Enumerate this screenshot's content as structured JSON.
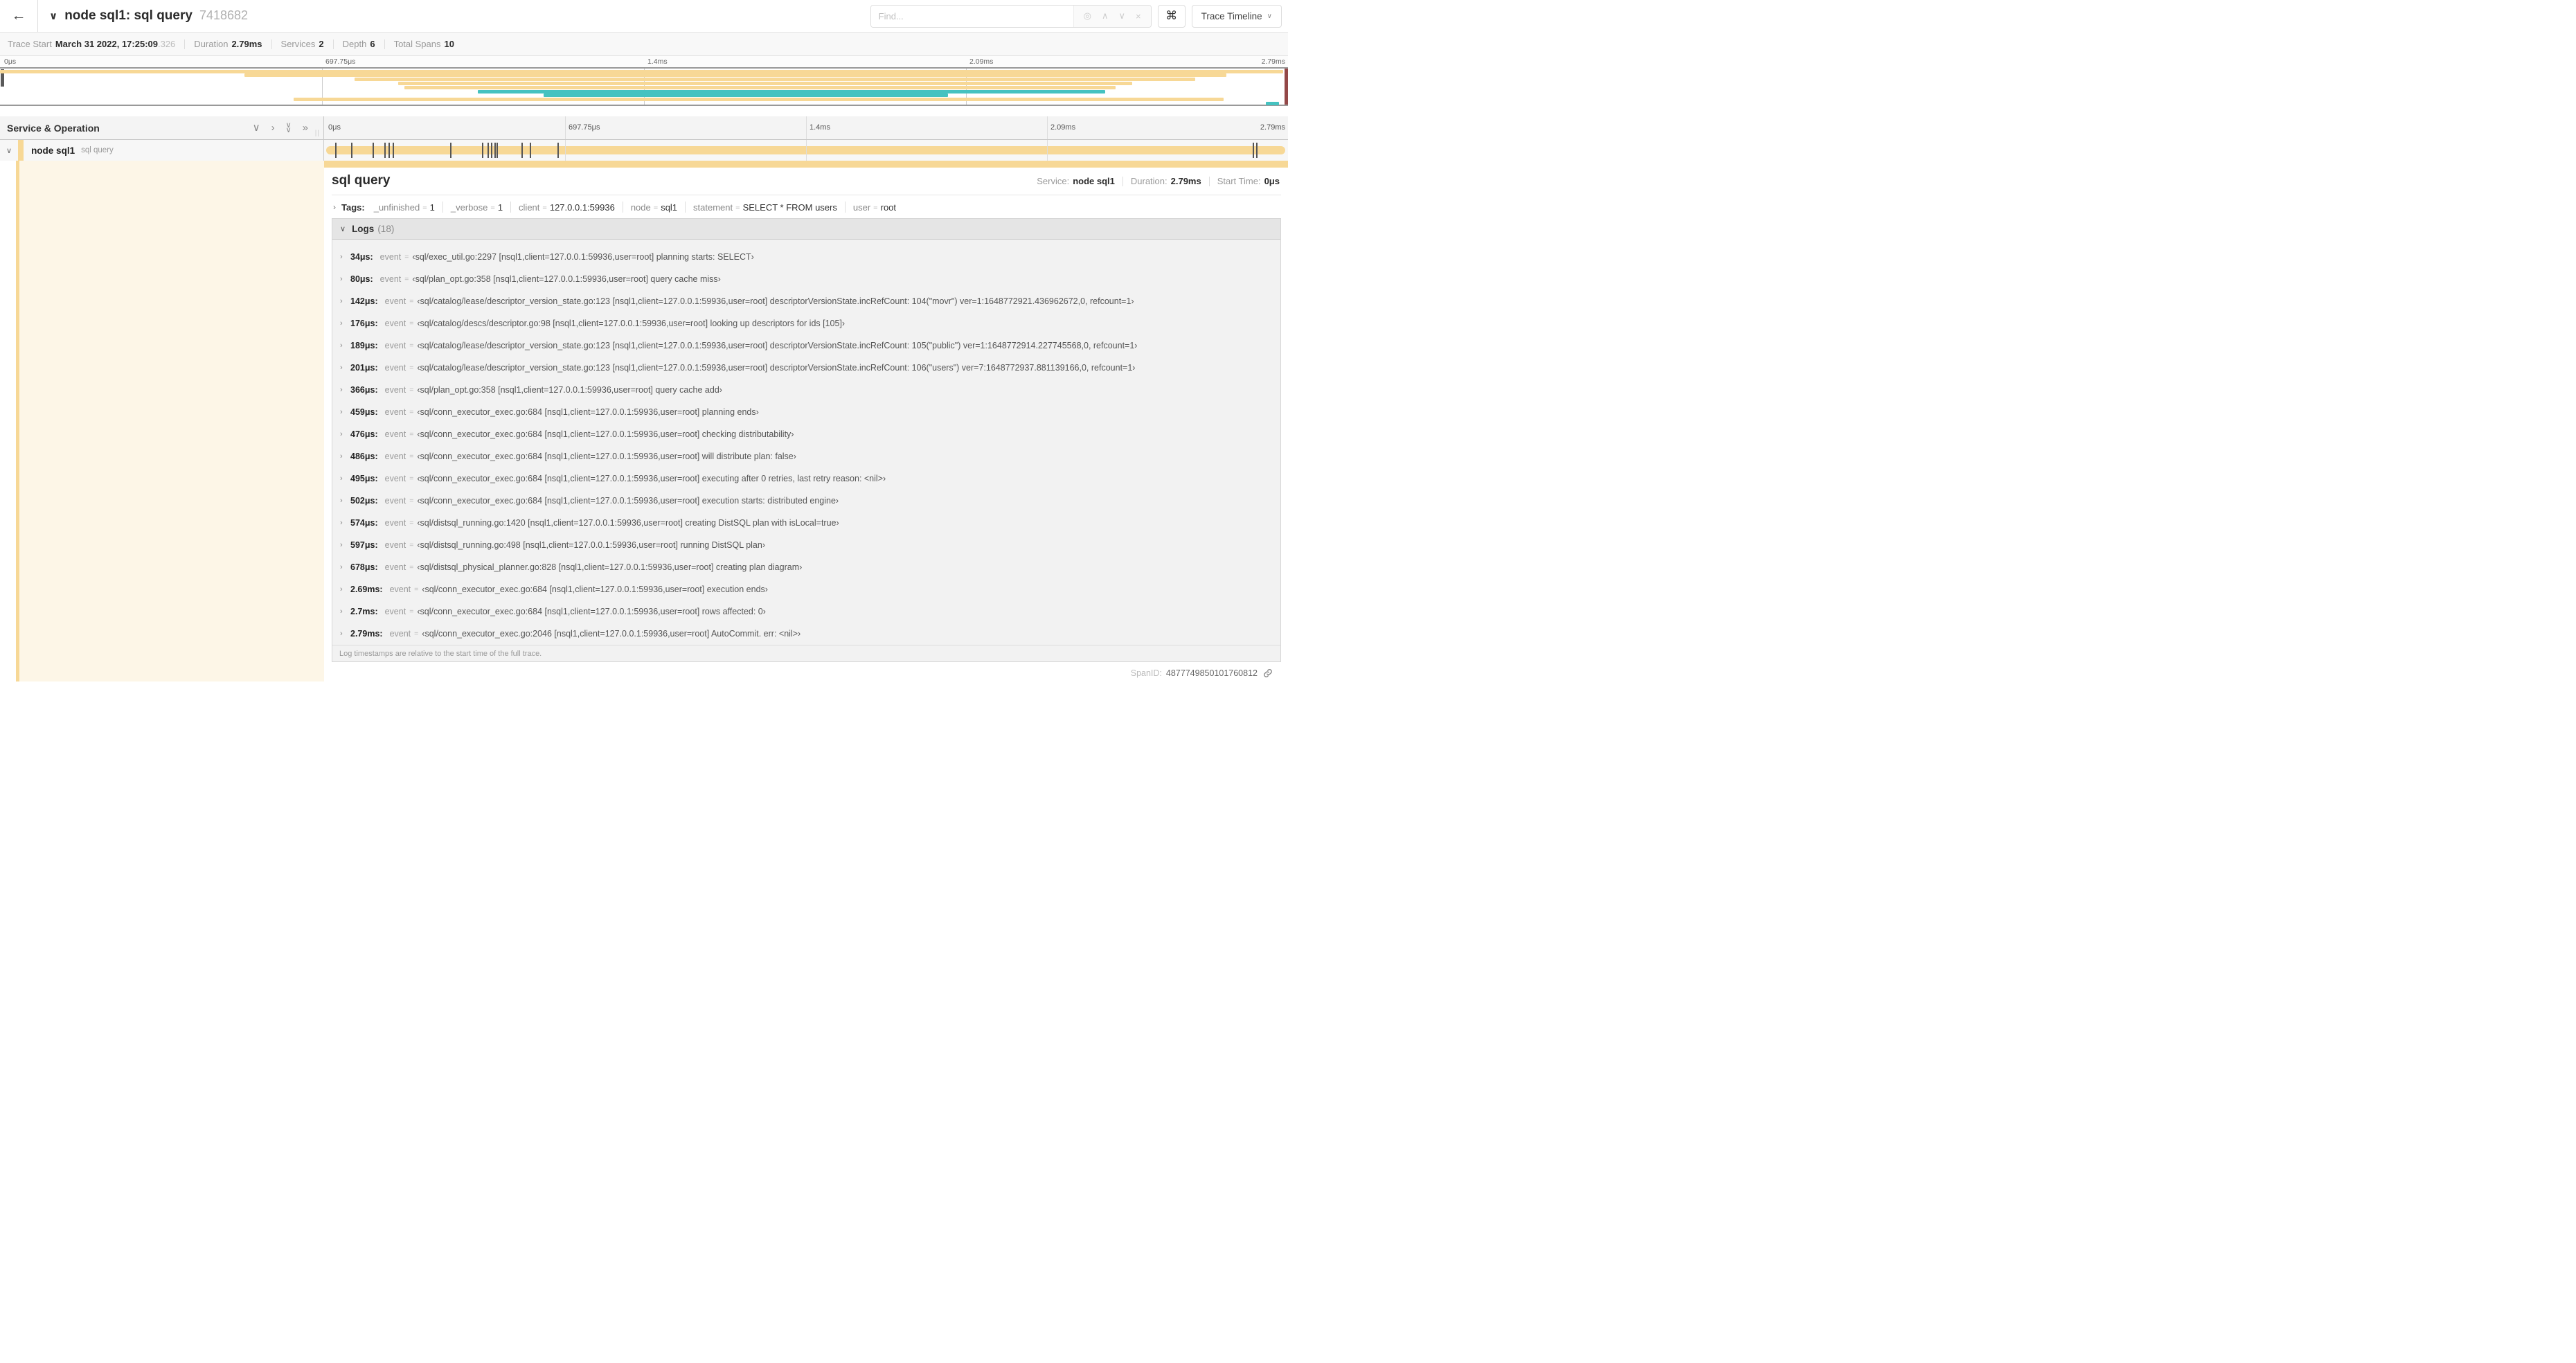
{
  "header": {
    "back_icon": "←",
    "collapse_icon": "∨",
    "title": "node sql1: sql query",
    "trace_id_short": "7418682",
    "find_placeholder": "Find...",
    "find_icons": [
      "◎",
      "∧",
      "∨",
      "×"
    ],
    "shortcut_button": "⌘",
    "view_select_label": "Trace Timeline",
    "view_select_chevron": "∨"
  },
  "summary": {
    "items": [
      {
        "label": "Trace Start",
        "value": "March 31 2022, 17:25:09",
        "suffix": ".326"
      },
      {
        "label": "Duration",
        "value": "2.79ms",
        "suffix": ""
      },
      {
        "label": "Services",
        "value": "2",
        "suffix": ""
      },
      {
        "label": "Depth",
        "value": "6",
        "suffix": ""
      },
      {
        "label": "Total Spans",
        "value": "10",
        "suffix": ""
      }
    ]
  },
  "timeline": {
    "ticks": [
      "0μs",
      "697.75μs",
      "1.4ms",
      "2.09ms",
      "2.79ms"
    ],
    "duration_us": 2790
  },
  "minimap": {
    "spans": [
      {
        "s": 0,
        "e": 99.6,
        "c": "main"
      },
      {
        "s": 19.0,
        "e": 95.2,
        "c": "main"
      },
      {
        "s": 27.5,
        "e": 92.8,
        "c": "main"
      },
      {
        "s": 30.9,
        "e": 87.9,
        "c": "main"
      },
      {
        "s": 31.4,
        "e": 86.6,
        "c": "main"
      },
      {
        "s": 37.1,
        "e": 85.8,
        "c": "alt"
      },
      {
        "s": 42.2,
        "e": 73.6,
        "c": "alt"
      },
      {
        "s": 22.8,
        "e": 95.0,
        "c": "main"
      },
      {
        "s": 98.3,
        "e": 99.3,
        "c": "alt"
      }
    ]
  },
  "table_header": {
    "left_title": "Service & Operation",
    "controls": [
      {
        "icon": "chevron-down-icon",
        "glyph": "∨"
      },
      {
        "icon": "chevron-right-icon",
        "glyph": "›"
      },
      {
        "icon": "double-chevron-down-icon",
        "glyph": "∨∨"
      },
      {
        "icon": "double-chevron-right-icon",
        "glyph": "»"
      }
    ],
    "grip": "||"
  },
  "span_row": {
    "chevron": "∨",
    "service": "node sql1",
    "operation": "sql query",
    "markers_us": [
      34,
      80,
      142,
      176,
      189,
      201,
      366,
      459,
      476,
      486,
      495,
      502,
      574,
      597,
      678,
      2690,
      2700
    ]
  },
  "detail": {
    "title": "sql query",
    "meta": [
      {
        "label": "Service:",
        "value": "node sql1"
      },
      {
        "label": "Duration:",
        "value": "2.79ms"
      },
      {
        "label": "Start Time:",
        "value": "0μs"
      }
    ],
    "tags_chevron": "›",
    "tags_label": "Tags:",
    "tags": [
      {
        "key": "_unfinished",
        "value": "1"
      },
      {
        "key": "_verbose",
        "value": "1"
      },
      {
        "key": "client",
        "value": "127.0.0.1:59936"
      },
      {
        "key": "node",
        "value": "sql1"
      },
      {
        "key": "statement",
        "value": "SELECT * FROM users"
      },
      {
        "key": "user",
        "value": "root"
      }
    ],
    "logs_chevron": "∨",
    "logs_label": "Logs",
    "logs_count": "(18)",
    "logs": [
      {
        "time": "34μs:",
        "field": "event",
        "value": "‹sql/exec_util.go:2297 [nsql1,client=127.0.0.1:59936,user=root] planning starts: SELECT›"
      },
      {
        "time": "80μs:",
        "field": "event",
        "value": "‹sql/plan_opt.go:358 [nsql1,client=127.0.0.1:59936,user=root] query cache miss›"
      },
      {
        "time": "142μs:",
        "field": "event",
        "value": "‹sql/catalog/lease/descriptor_version_state.go:123 [nsql1,client=127.0.0.1:59936,user=root] descriptorVersionState.incRefCount: 104(\"movr\") ver=1:1648772921.436962672,0, refcount=1›"
      },
      {
        "time": "176μs:",
        "field": "event",
        "value": "‹sql/catalog/descs/descriptor.go:98 [nsql1,client=127.0.0.1:59936,user=root] looking up descriptors for ids [105]›"
      },
      {
        "time": "189μs:",
        "field": "event",
        "value": "‹sql/catalog/lease/descriptor_version_state.go:123 [nsql1,client=127.0.0.1:59936,user=root] descriptorVersionState.incRefCount: 105(\"public\") ver=1:1648772914.227745568,0, refcount=1›"
      },
      {
        "time": "201μs:",
        "field": "event",
        "value": "‹sql/catalog/lease/descriptor_version_state.go:123 [nsql1,client=127.0.0.1:59936,user=root] descriptorVersionState.incRefCount: 106(\"users\") ver=7:1648772937.881139166,0, refcount=1›"
      },
      {
        "time": "366μs:",
        "field": "event",
        "value": "‹sql/plan_opt.go:358 [nsql1,client=127.0.0.1:59936,user=root] query cache add›"
      },
      {
        "time": "459μs:",
        "field": "event",
        "value": "‹sql/conn_executor_exec.go:684 [nsql1,client=127.0.0.1:59936,user=root] planning ends›"
      },
      {
        "time": "476μs:",
        "field": "event",
        "value": "‹sql/conn_executor_exec.go:684 [nsql1,client=127.0.0.1:59936,user=root] checking distributability›"
      },
      {
        "time": "486μs:",
        "field": "event",
        "value": "‹sql/conn_executor_exec.go:684 [nsql1,client=127.0.0.1:59936,user=root] will distribute plan: false›"
      },
      {
        "time": "495μs:",
        "field": "event",
        "value": "‹sql/conn_executor_exec.go:684 [nsql1,client=127.0.0.1:59936,user=root] executing after 0 retries, last retry reason: <nil>›"
      },
      {
        "time": "502μs:",
        "field": "event",
        "value": "‹sql/conn_executor_exec.go:684 [nsql1,client=127.0.0.1:59936,user=root] execution starts: distributed engine›"
      },
      {
        "time": "574μs:",
        "field": "event",
        "value": "‹sql/distsql_running.go:1420 [nsql1,client=127.0.0.1:59936,user=root] creating DistSQL plan with isLocal=true›"
      },
      {
        "time": "597μs:",
        "field": "event",
        "value": "‹sql/distsql_running.go:498 [nsql1,client=127.0.0.1:59936,user=root] running DistSQL plan›"
      },
      {
        "time": "678μs:",
        "field": "event",
        "value": "‹sql/distsql_physical_planner.go:828 [nsql1,client=127.0.0.1:59936,user=root] creating plan diagram›"
      },
      {
        "time": "2.69ms:",
        "field": "event",
        "value": "‹sql/conn_executor_exec.go:684 [nsql1,client=127.0.0.1:59936,user=root] execution ends›"
      },
      {
        "time": "2.7ms:",
        "field": "event",
        "value": "‹sql/conn_executor_exec.go:684 [nsql1,client=127.0.0.1:59936,user=root] rows affected: 0›"
      },
      {
        "time": "2.79ms:",
        "field": "event",
        "value": "‹sql/conn_executor_exec.go:2046 [nsql1,client=127.0.0.1:59936,user=root] AutoCommit. err: <nil>›"
      }
    ],
    "footer_note": "Log timestamps are relative to the start time of the full trace.",
    "spanid_label": "SpanID:",
    "spanid_value": "4877749850101760812"
  },
  "colors": {
    "span_main": "#f7d896",
    "span_alt": "#45c2c0",
    "span_tint": "#fdf6e7"
  }
}
